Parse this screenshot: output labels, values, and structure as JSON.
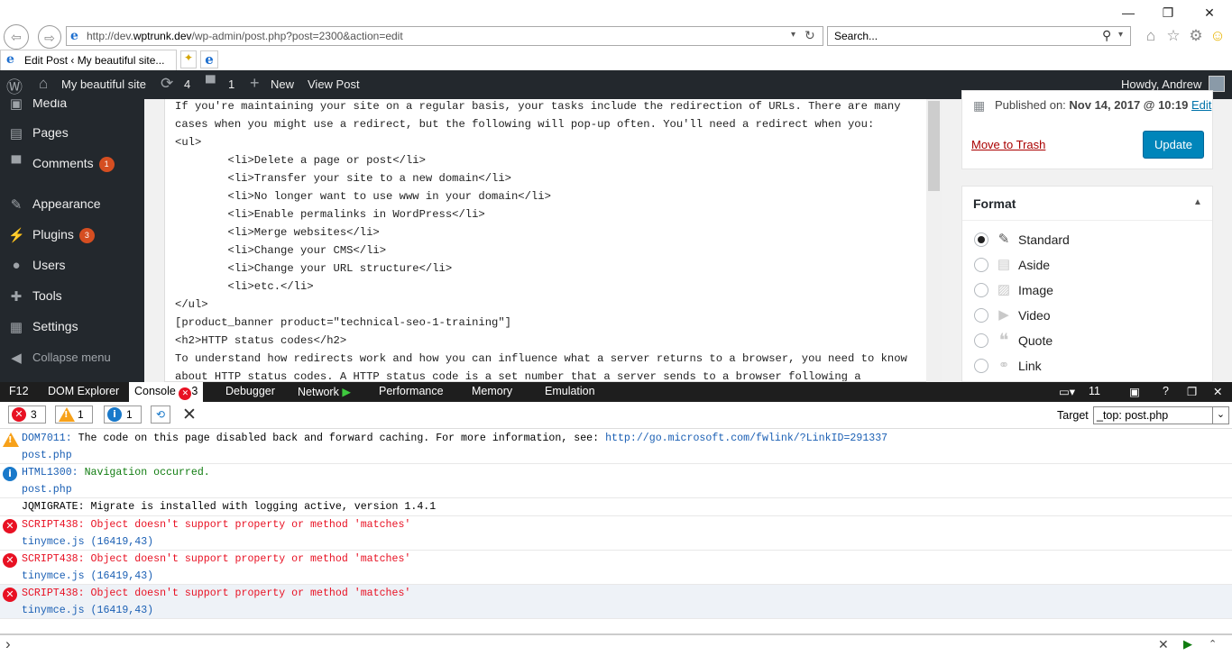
{
  "browser": {
    "url_prefix": "http://dev.",
    "url_host": "wptrunk.dev",
    "url_path": "/wp-admin/post.php?post=2300&action=edit",
    "search_placeholder": "Search...",
    "tab_title": "Edit Post ‹ My beautiful site...",
    "win_minimize": "—",
    "win_restore": "❐",
    "win_close": "✕"
  },
  "adminbar": {
    "site_name": "My beautiful site",
    "updates_count": "4",
    "comments_count": "1",
    "new_label": "New",
    "view_post": "View Post",
    "howdy": "Howdy, Andrew"
  },
  "sidebar": {
    "items": [
      {
        "label": "Media",
        "icon": "media-icon"
      },
      {
        "label": "Pages",
        "icon": "pages-icon"
      },
      {
        "label": "Comments",
        "icon": "comments-icon",
        "badge": "1"
      },
      {
        "label": "Appearance",
        "icon": "appearance-icon"
      },
      {
        "label": "Plugins",
        "icon": "plugins-icon",
        "badge": "3"
      },
      {
        "label": "Users",
        "icon": "users-icon"
      },
      {
        "label": "Tools",
        "icon": "tools-icon"
      },
      {
        "label": "Settings",
        "icon": "settings-icon"
      },
      {
        "label": "Collapse menu",
        "icon": "collapse-icon"
      }
    ]
  },
  "editor": {
    "lines": [
      "If you're maintaining your site on a regular basis, your tasks include the redirection of URLs. There are many",
      "cases when you might use a redirect, but the following will pop-up often. You'll need a redirect when you:",
      "<ul>",
      "        <li>Delete a page or post</li>",
      "        <li>Transfer your site to a new domain</li>",
      "        <li>No longer want to use www in your domain</li>",
      "        <li>Enable permalinks in WordPress</li>",
      "        <li>Merge websites</li>",
      "        <li>Change your CMS</li>",
      "        <li>Change your URL structure</li>",
      "        <li>etc.</li>",
      "</ul>",
      "[product_banner product=\"technical-seo-1-training\"]",
      "<h2>HTTP status codes</h2>",
      "To understand how redirects work and how you can influence what a server returns to a browser, you need to know",
      "about HTTP status codes. A HTTP status code is a set number that a server sends to a browser following a"
    ]
  },
  "publish": {
    "published_label": "Published on:",
    "published_date": "Nov 14, 2017 @ 10:19",
    "edit_link": "Edit",
    "trash_link": "Move to Trash",
    "update_button": "Update"
  },
  "format": {
    "title": "Format",
    "options": [
      {
        "label": "Standard",
        "icon": "pin-icon",
        "selected": true
      },
      {
        "label": "Aside",
        "icon": "aside-icon",
        "selected": false
      },
      {
        "label": "Image",
        "icon": "image-icon",
        "selected": false
      },
      {
        "label": "Video",
        "icon": "video-icon",
        "selected": false
      },
      {
        "label": "Quote",
        "icon": "quote-icon",
        "selected": false
      },
      {
        "label": "Link",
        "icon": "link-icon",
        "selected": false
      }
    ]
  },
  "devtools": {
    "tabs": [
      "F12",
      "DOM Explorer",
      "Console",
      "Debugger",
      "Network",
      "Performance",
      "Memory",
      "Emulation"
    ],
    "console_error_count": "3",
    "doc_mode": "11",
    "filters": {
      "errors": "3",
      "warnings": "1",
      "messages": "1"
    },
    "target_label": "Target",
    "target_value": "_top: post.php",
    "entries": [
      {
        "type": "warning",
        "code": "DOM7011:",
        "text": " The code on this page disabled back and forward caching. For more information, see: ",
        "link": "http://go.microsoft.com/fwlink/?LinkID=291337",
        "source": "post.php"
      },
      {
        "type": "info",
        "code": "HTML1300:",
        "text": " Navigation occurred.",
        "source": "post.php"
      },
      {
        "type": "log",
        "text": "JQMIGRATE: Migrate is installed with logging active, version 1.4.1"
      },
      {
        "type": "error",
        "code": "SCRIPT438:",
        "text": " Object doesn't support property or method 'matches'",
        "source": "tinymce.js (16419,43)"
      },
      {
        "type": "error",
        "code": "SCRIPT438:",
        "text": " Object doesn't support property or method 'matches'",
        "source": "tinymce.js (16419,43)"
      },
      {
        "type": "error",
        "code": "SCRIPT438:",
        "text": " Object doesn't support property or method 'matches'",
        "source": "tinymce.js (16419,43)"
      }
    ],
    "prompt": "›"
  },
  "colors": {
    "wp_dark": "#23282d",
    "wp_blue": "#0085ba",
    "badge": "#d54e21",
    "error": "#e81123"
  }
}
